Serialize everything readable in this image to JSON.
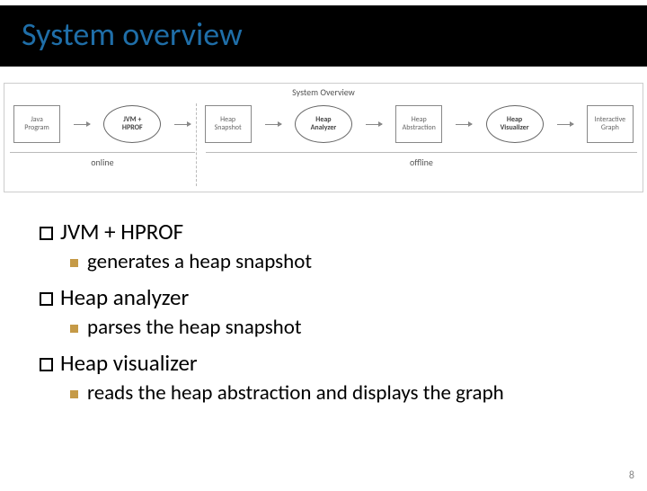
{
  "title": "System overview",
  "diagram": {
    "title": "System Overview",
    "nodes": [
      {
        "label": "Java\nProgram",
        "shape": "box"
      },
      {
        "label": "JVM +\nHPROF",
        "shape": "oval"
      },
      {
        "label": "Heap\nSnapshot",
        "shape": "box"
      },
      {
        "label": "Heap\nAnalyzer",
        "shape": "oval"
      },
      {
        "label": "Heap\nAbstraction",
        "shape": "box"
      },
      {
        "label": "Heap\nVisualizer",
        "shape": "oval"
      },
      {
        "label": "Interactive\nGraph",
        "shape": "box"
      }
    ],
    "phases": {
      "online": "online",
      "offline": "offline"
    }
  },
  "bullets": {
    "a": {
      "title": "JVM + HPROF",
      "sub": "generates a heap snapshot"
    },
    "b": {
      "title": "Heap analyzer",
      "sub": "parses the heap snapshot"
    },
    "c": {
      "title": "Heap visualizer",
      "sub": "reads the heap abstraction and displays the graph"
    }
  },
  "page": "8"
}
